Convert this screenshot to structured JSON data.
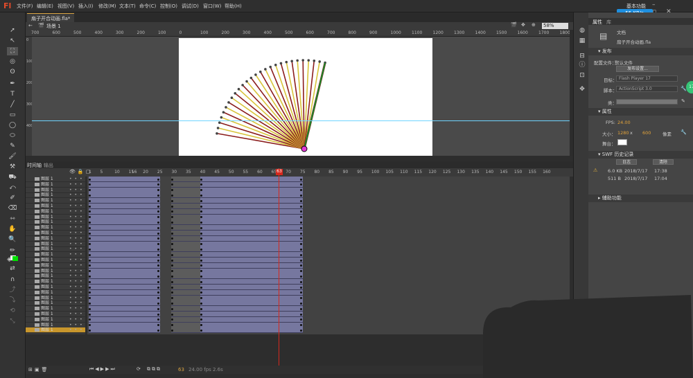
{
  "app": {
    "logo": "Fl",
    "workspace": "基本功能",
    "network_badge": "55 KB/s"
  },
  "menu": [
    "文件(F)",
    "编辑(E)",
    "视图(V)",
    "插入(I)",
    "修改(M)",
    "文本(T)",
    "命令(C)",
    "控制(O)",
    "调试(D)",
    "窗口(W)",
    "帮助(H)"
  ],
  "document": {
    "tab": "扇子开合动画.fla*",
    "scene": "场景 1",
    "zoom": "58%"
  },
  "ruler": {
    "top_ticks": [
      "700",
      "600",
      "500",
      "400",
      "300",
      "200",
      "100",
      "0",
      "100",
      "200",
      "300",
      "400",
      "500",
      "600",
      "700",
      "800",
      "900",
      "1000",
      "1100",
      "1200",
      "1300",
      "1400",
      "1500",
      "1600",
      "1700",
      "1800"
    ],
    "left_ticks": [
      "0",
      "100",
      "200",
      "300",
      "400"
    ]
  },
  "timeline": {
    "tabs": [
      "时间轴",
      "输出"
    ],
    "frame_numbers": [
      "1",
      "5",
      "10",
      "15",
      "20",
      "25",
      "30",
      "35",
      "40",
      "45",
      "50",
      "55",
      "60",
      "65",
      "70",
      "75",
      "80",
      "85",
      "90",
      "95",
      "100",
      "105",
      "110",
      "115",
      "120",
      "125",
      "130",
      "135",
      "140",
      "145",
      "150",
      "155",
      "160",
      "16"
    ],
    "layer_name": "图层 1",
    "layer_count": 29,
    "playhead_frame": 63,
    "tweens": [
      [
        1,
        25
      ],
      [
        40,
        75
      ]
    ],
    "keyframes": [
      1,
      25,
      30,
      40,
      75
    ],
    "status": [
      "24.00 fps",
      "2.6s"
    ],
    "current_frame": "63"
  },
  "properties": {
    "tabs": [
      "属性",
      "库"
    ],
    "doc_label": "文档",
    "doc_name": "扇子开合动画.fla",
    "publish_section": "发布",
    "profile_label": "配置文件：",
    "profile_value": "默认文件",
    "publish_settings": "发布设置...",
    "target_label": "目标：",
    "target_value": "Flash Player 17",
    "script_label": "脚本：",
    "script_value": "ActionScript 3.0",
    "class_label": "类：",
    "props_section": "属性",
    "fps_label": "FPS:",
    "fps_value": "24.00",
    "size_label": "大小：",
    "width": "1280",
    "x_sep": "x",
    "height": "600",
    "units": "像素",
    "stage_label": "舞台：",
    "swf_section": "SWF 历史记录",
    "log_button": "日志",
    "clear_button": "清除",
    "history": [
      {
        "size": "6.0 KB",
        "date": "2018/7/17",
        "time": "17:38",
        "warn": true
      },
      {
        "size": "511 B",
        "date": "2018/7/17",
        "time": "17:04",
        "warn": false
      }
    ],
    "accessibility_section": "辅助功能",
    "badge": "17"
  },
  "colors": {
    "accent": "#d9a441",
    "tween": "#76779f",
    "playhead": "#d6281d",
    "guide": "#6fd4ff",
    "fill_swatch": "#00e000"
  }
}
